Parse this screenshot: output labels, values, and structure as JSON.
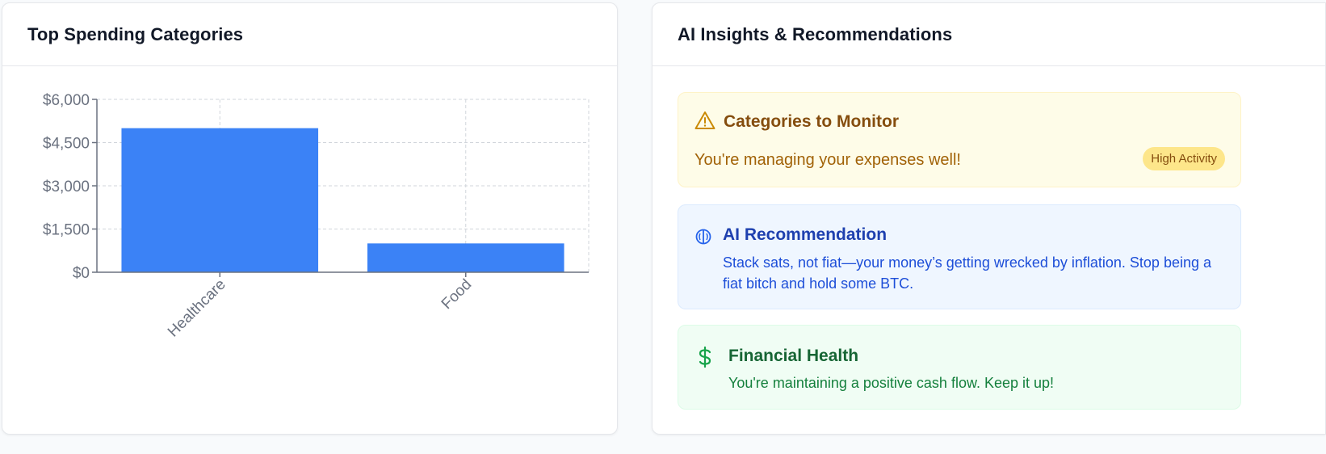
{
  "left_card": {
    "title": "Top Spending Categories"
  },
  "chart_data": {
    "type": "bar",
    "categories": [
      "Healthcare",
      "Food"
    ],
    "values": [
      5000,
      1000
    ],
    "yticks": [
      "$0",
      "$1,500",
      "$3,000",
      "$4,500",
      "$6,000"
    ],
    "ytick_values": [
      0,
      1500,
      3000,
      4500,
      6000
    ],
    "ylim": [
      0,
      6000
    ],
    "grid": true,
    "bar_color": "#3b82f6"
  },
  "right_card": {
    "title": "AI Insights & Recommendations",
    "monitor": {
      "icon": "warning-triangle-icon",
      "title": "Categories to Monitor",
      "text": "You're managing your expenses well!",
      "badge": "High Activity"
    },
    "recommendation": {
      "icon": "brain-icon",
      "title": "AI Recommendation",
      "text": "Stack sats, not fiat—your money’s getting wrecked by inflation. Stop being a fiat bitch and hold some BTC."
    },
    "health": {
      "icon": "dollar-sign-icon",
      "title": "Financial Health",
      "text": "You're maintaining a positive cash flow. Keep it up!"
    }
  },
  "colors": {
    "yellow_bg": "#fefce8",
    "blue_bg": "#eff6ff",
    "green_bg": "#f0fdf4",
    "accent_blue": "#3b82f6"
  }
}
